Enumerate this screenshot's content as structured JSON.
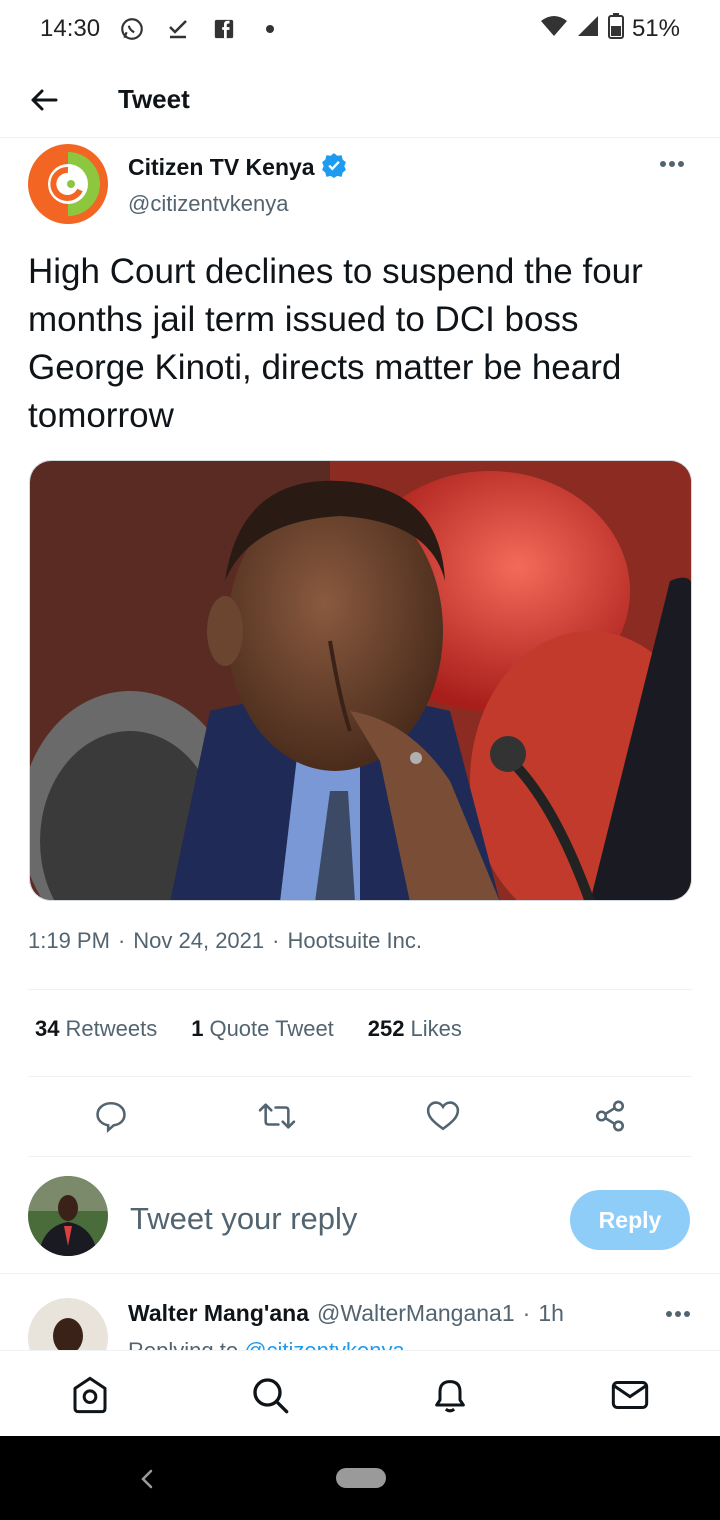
{
  "status_bar": {
    "time": "14:30",
    "battery": "51%",
    "left_icons": [
      "whatsapp-icon",
      "check-download-icon",
      "facebook-icon",
      "dot-icon"
    ],
    "right_icons": [
      "wifi-icon",
      "signal-icon",
      "battery-icon"
    ]
  },
  "header": {
    "title": "Tweet"
  },
  "tweet": {
    "author_name": "Citizen TV Kenya",
    "author_handle": "@citizentvkenya",
    "verified": true,
    "text": "High Court declines to suspend the four months jail term issued to DCI boss George Kinoti, directs matter be heard tomorrow",
    "time": "1:19 PM",
    "date": "Nov 24, 2021",
    "source": "Hootsuite Inc.",
    "separator": "·"
  },
  "stats": [
    {
      "count": "34",
      "label": "Retweets"
    },
    {
      "count": "1",
      "label": "Quote Tweet"
    },
    {
      "count": "252",
      "label": "Likes"
    }
  ],
  "reply_box": {
    "placeholder": "Tweet your reply",
    "button_label": "Reply"
  },
  "reply_item": {
    "name": "Walter Mang'ana",
    "handle": "@WalterManganа1",
    "time": "1h",
    "context_prefix": "Replying to",
    "context_link": "@citizentvkenya"
  },
  "colors": {
    "accent": "#1d9bf0",
    "reply_button": "#8ecdf8",
    "muted": "#536471"
  }
}
